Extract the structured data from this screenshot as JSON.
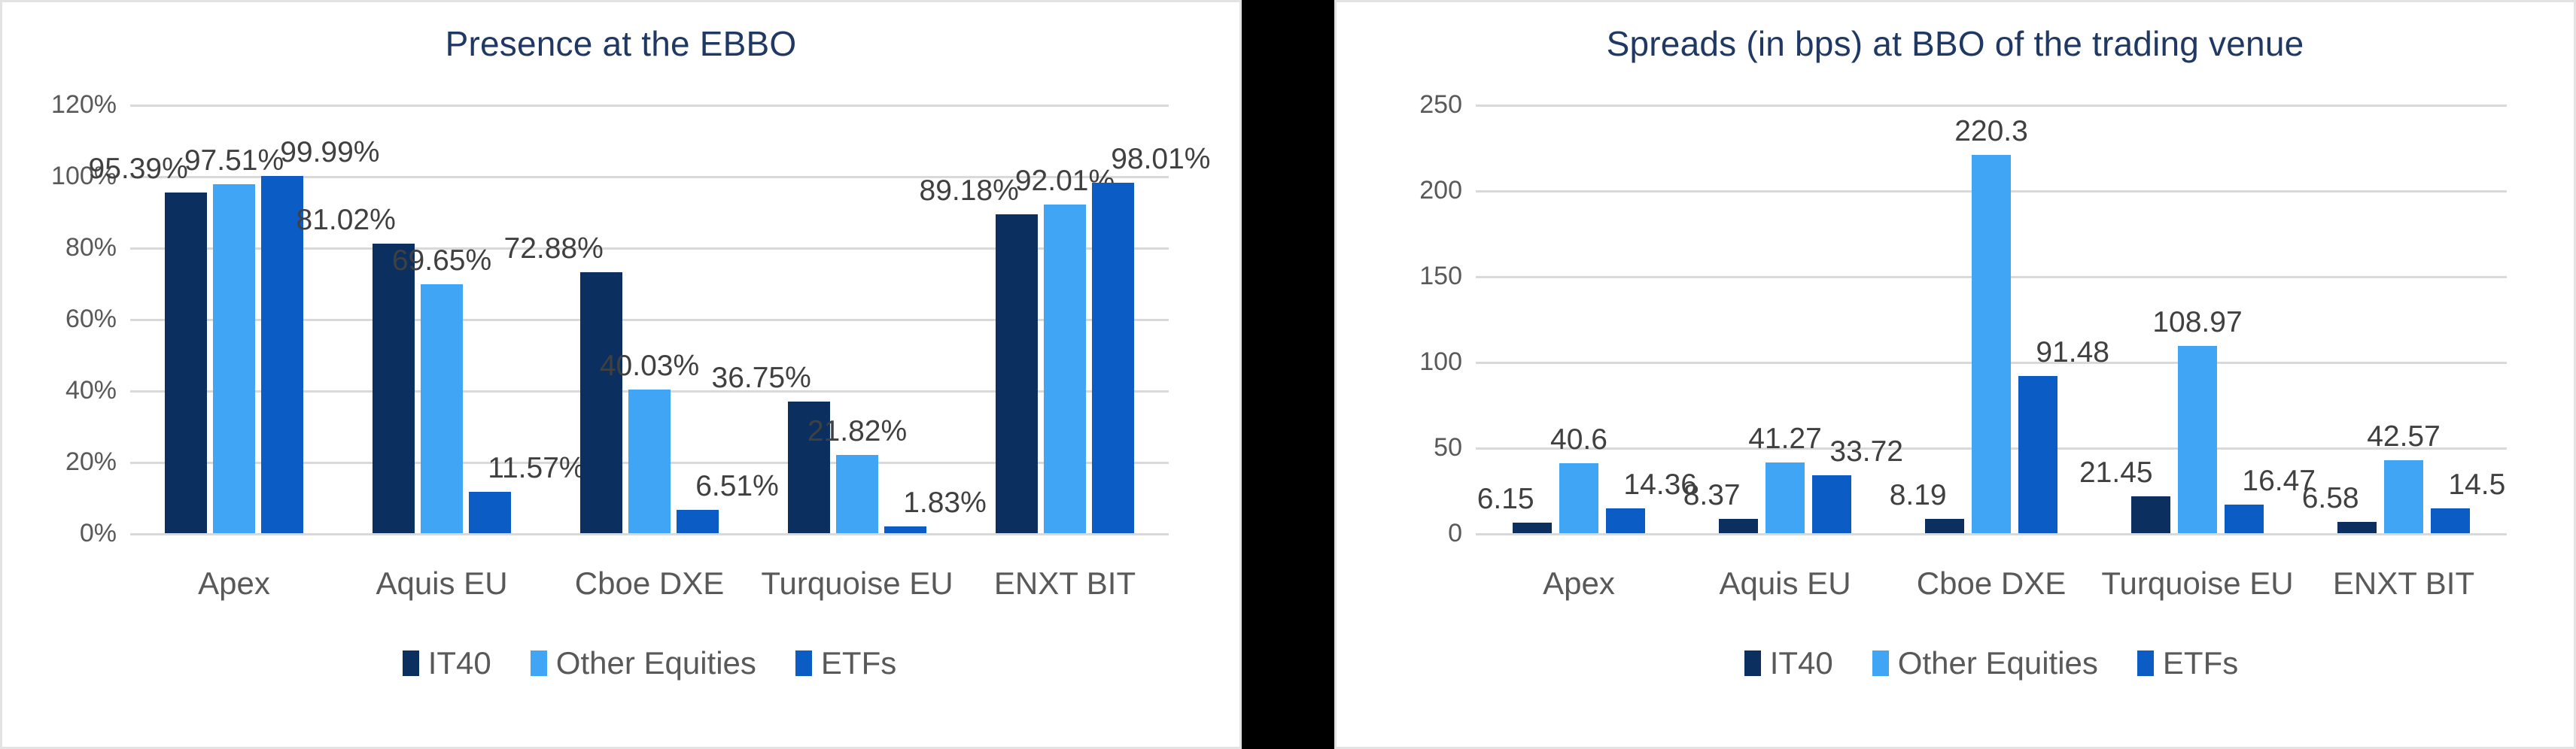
{
  "colors": {
    "series_it40": "#0B2F5E",
    "series_other_equities": "#41A5F5",
    "series_etfs": "#0B5CC4",
    "title": "#1F3864",
    "gridline": "#D9D9D9",
    "tick_text": "#595959",
    "data_label_text": "#404040",
    "panel_background": "#FFFFFF",
    "divider": "#000000"
  },
  "left_panel": {
    "title": "Presence at the EBBO",
    "legend": [
      {
        "label": "IT40",
        "color": "#0B2F5E"
      },
      {
        "label": "Other Equities",
        "color": "#41A5F5"
      },
      {
        "label": "ETFs",
        "color": "#0B5CC4"
      }
    ]
  },
  "right_panel": {
    "title": "Spreads (in bps) at BBO of the trading venue",
    "legend": [
      {
        "label": "IT40",
        "color": "#0B2F5E"
      },
      {
        "label": "Other Equities",
        "color": "#41A5F5"
      },
      {
        "label": "ETFs",
        "color": "#0B5CC4"
      }
    ]
  },
  "chart_data": [
    {
      "type": "bar",
      "title": "Presence at the EBBO",
      "xlabel": "",
      "ylabel": "",
      "ylim": [
        0,
        120
      ],
      "ytick_values": [
        0,
        20,
        40,
        60,
        80,
        100,
        120
      ],
      "ytick_labels": [
        "0%",
        "20%",
        "40%",
        "60%",
        "80%",
        "100%",
        "120%"
      ],
      "grid": true,
      "legend_position": "bottom",
      "categories": [
        "Apex",
        "Aquis EU",
        "Cboe DXE",
        "Turquoise EU",
        "ENXT BIT"
      ],
      "series": [
        {
          "name": "IT40",
          "color": "#0B2F5E",
          "values": [
            95.39,
            81.02,
            72.88,
            36.75,
            89.18
          ],
          "labels": [
            "95.39%",
            "81.02%",
            "72.88%",
            "36.75%",
            "89.18%"
          ]
        },
        {
          "name": "Other Equities",
          "color": "#41A5F5",
          "values": [
            97.51,
            69.65,
            40.03,
            21.82,
            92.01
          ],
          "labels": [
            "97.51%",
            "69.65%",
            "40.03%",
            "21.82%",
            "92.01%"
          ]
        },
        {
          "name": "ETFs",
          "color": "#0B5CC4",
          "values": [
            99.99,
            11.57,
            6.51,
            1.83,
            98.01
          ],
          "labels": [
            "99.99%",
            "11.57%",
            "6.51%",
            "1.83%",
            "98.01%"
          ]
        }
      ]
    },
    {
      "type": "bar",
      "title": "Spreads (in bps) at BBO of the trading venue",
      "xlabel": "",
      "ylabel": "",
      "ylim": [
        0,
        250
      ],
      "ytick_values": [
        0,
        50,
        100,
        150,
        200,
        250
      ],
      "ytick_labels": [
        "0",
        "50",
        "100",
        "150",
        "200",
        "250"
      ],
      "grid": true,
      "legend_position": "bottom",
      "categories": [
        "Apex",
        "Aquis EU",
        "Cboe DXE",
        "Turquoise EU",
        "ENXT BIT"
      ],
      "series": [
        {
          "name": "IT40",
          "color": "#0B2F5E",
          "values": [
            6.15,
            8.37,
            8.19,
            21.45,
            6.58
          ],
          "labels": [
            "6.15",
            "8.37",
            "8.19",
            "21.45",
            "6.58"
          ]
        },
        {
          "name": "Other Equities",
          "color": "#41A5F5",
          "values": [
            40.6,
            41.27,
            220.3,
            108.97,
            42.57
          ],
          "labels": [
            "40.6",
            "41.27",
            "220.3",
            "108.97",
            "42.57"
          ]
        },
        {
          "name": "ETFs",
          "color": "#0B5CC4",
          "values": [
            14.36,
            33.72,
            91.48,
            16.47,
            14.5
          ],
          "labels": [
            "14.36",
            "33.72",
            "91.48",
            "16.47",
            "14.5"
          ]
        }
      ]
    }
  ]
}
